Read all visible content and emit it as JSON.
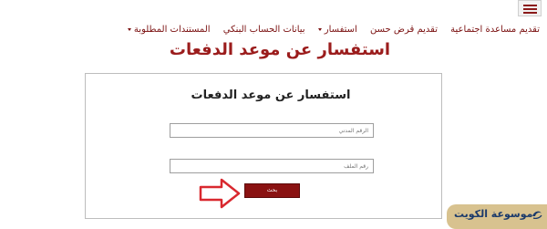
{
  "header": {
    "menu_icon": "hamburger-icon"
  },
  "nav": {
    "items": [
      {
        "label": "تقديم مساعدة اجتماعية",
        "has_caret": false
      },
      {
        "label": "تقديم قرض حسن",
        "has_caret": false
      },
      {
        "label": "استفسار",
        "has_caret": true
      },
      {
        "label": "بيانات الحساب البنكي",
        "has_caret": false
      },
      {
        "label": "المستندات المطلوبة",
        "has_caret": true
      }
    ]
  },
  "page": {
    "title": "استفسار عن موعد الدفعات"
  },
  "form": {
    "title": "استفسار عن موعد الدفعات",
    "civil_id_placeholder": "الرقم المدني",
    "file_number_placeholder": "رقم الملف",
    "search_label": "بحث"
  },
  "overlay": {
    "arrow_icon": "arrow-right-outline-icon",
    "arrow_color": "#d9282f"
  },
  "watermark": {
    "text": "موسوعة الكويت",
    "background_color": "#d8c28f",
    "text_color": "#1b3a6b"
  },
  "colors": {
    "accent": "#8a1212",
    "title": "#9b1c1c"
  }
}
